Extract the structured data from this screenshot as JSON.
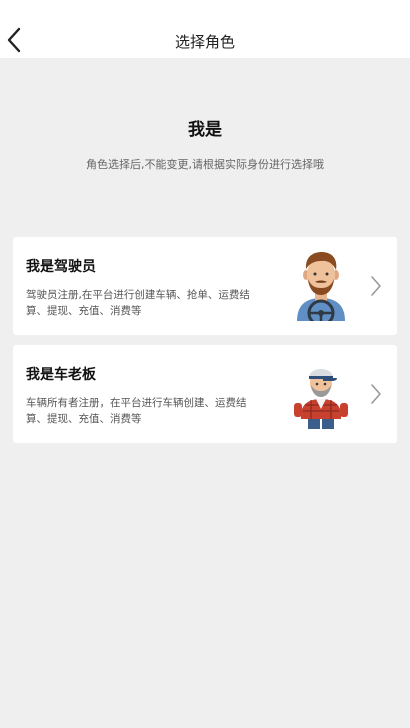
{
  "header": {
    "title": "选择角色",
    "back_icon": "chevron-left-icon"
  },
  "intro": {
    "heading": "我是",
    "subtitle": "角色选择后,不能变更,请根据实际身份进行选择哦"
  },
  "roles": [
    {
      "title": "我是驾驶员",
      "description": "驾驶员注册,在平台进行创建车辆、抢单、运费结算、提现、充值、消费等",
      "avatar": "driver-avatar-illustration"
    },
    {
      "title": "我是车老板",
      "description": "车辆所有者注册，在平台进行车辆创建、运费结算、提现、充值、消费等",
      "avatar": "vehicle-owner-avatar-illustration"
    }
  ],
  "colors": {
    "background": "#efefef",
    "card": "#ffffff",
    "chevron": "#999999"
  }
}
